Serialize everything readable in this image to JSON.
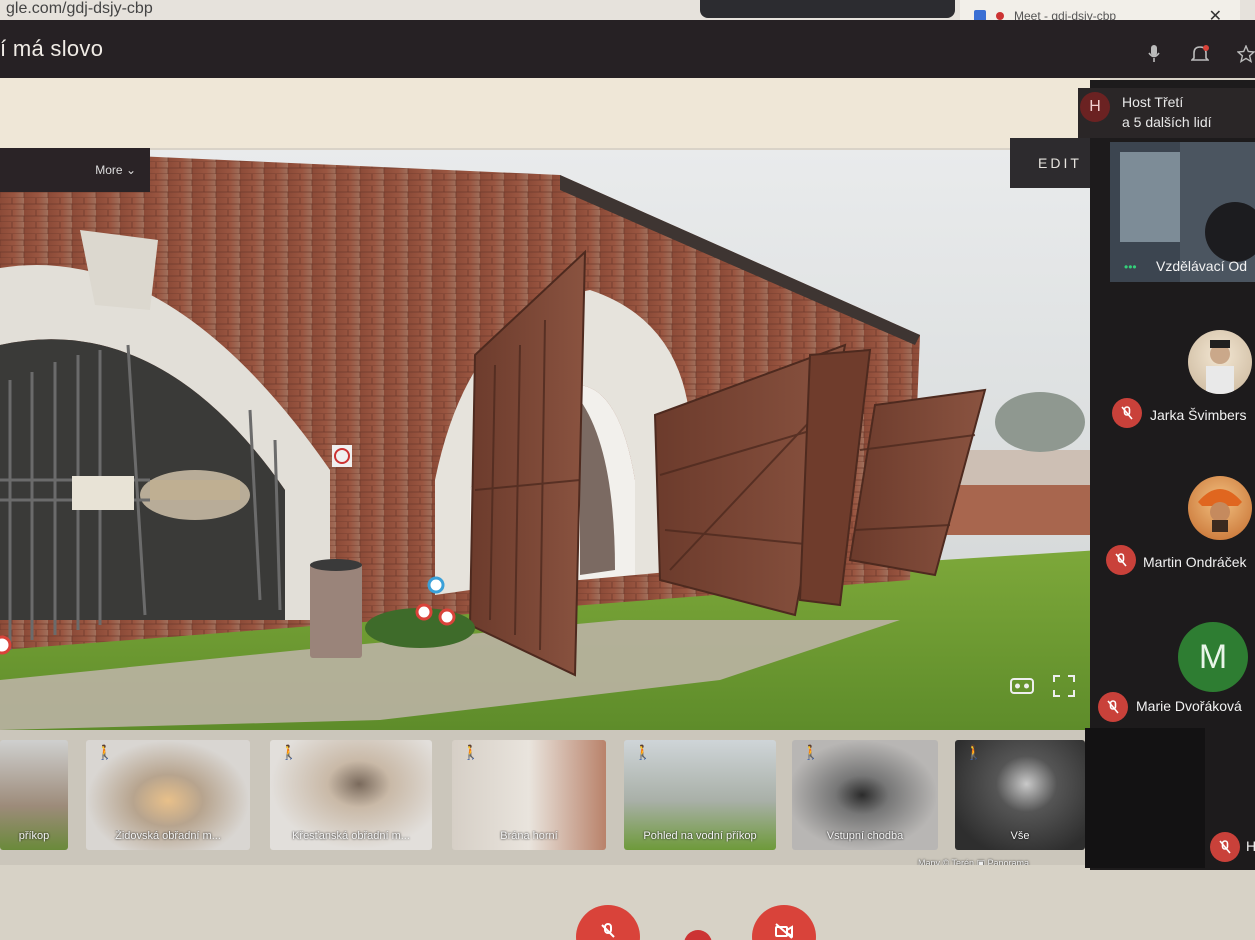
{
  "browser": {
    "url_fragment": "gle.com/gdj-dsjy-cbp",
    "tab_title": "Meet - gdj-dsjy-cbp",
    "close_glyph": "✕"
  },
  "site": {
    "heading": "í má slovo",
    "more_label": "More ⌄",
    "edit_label": "EDIT"
  },
  "thumbnails": [
    {
      "caption": "příkop"
    },
    {
      "caption": "Židovská obřadní m..."
    },
    {
      "caption": "Křesťanská obřadní m..."
    },
    {
      "caption": "Brána horní"
    },
    {
      "caption": "Pohled na vodní příkop"
    },
    {
      "caption": "Vstupní chodba"
    },
    {
      "caption": "Vše"
    }
  ],
  "credit": "Mapy © Terén  ▣ Panorama",
  "meet": {
    "host_initial": "H",
    "host_line1": "Host Třetí",
    "host_line2": "a 5 dalších lidí",
    "tile_name": "Vzdělávací Od",
    "participants": [
      {
        "name": "Jarka Švimbers"
      },
      {
        "name": "Martin Ondráček"
      },
      {
        "name": "Marie Dvořáková",
        "initial": "M"
      }
    ],
    "last_initial": "H"
  },
  "colors": {
    "accent_red": "#d9433a",
    "meet_dark": "#1d1b1c",
    "avatar_green": "#2e7d32"
  }
}
